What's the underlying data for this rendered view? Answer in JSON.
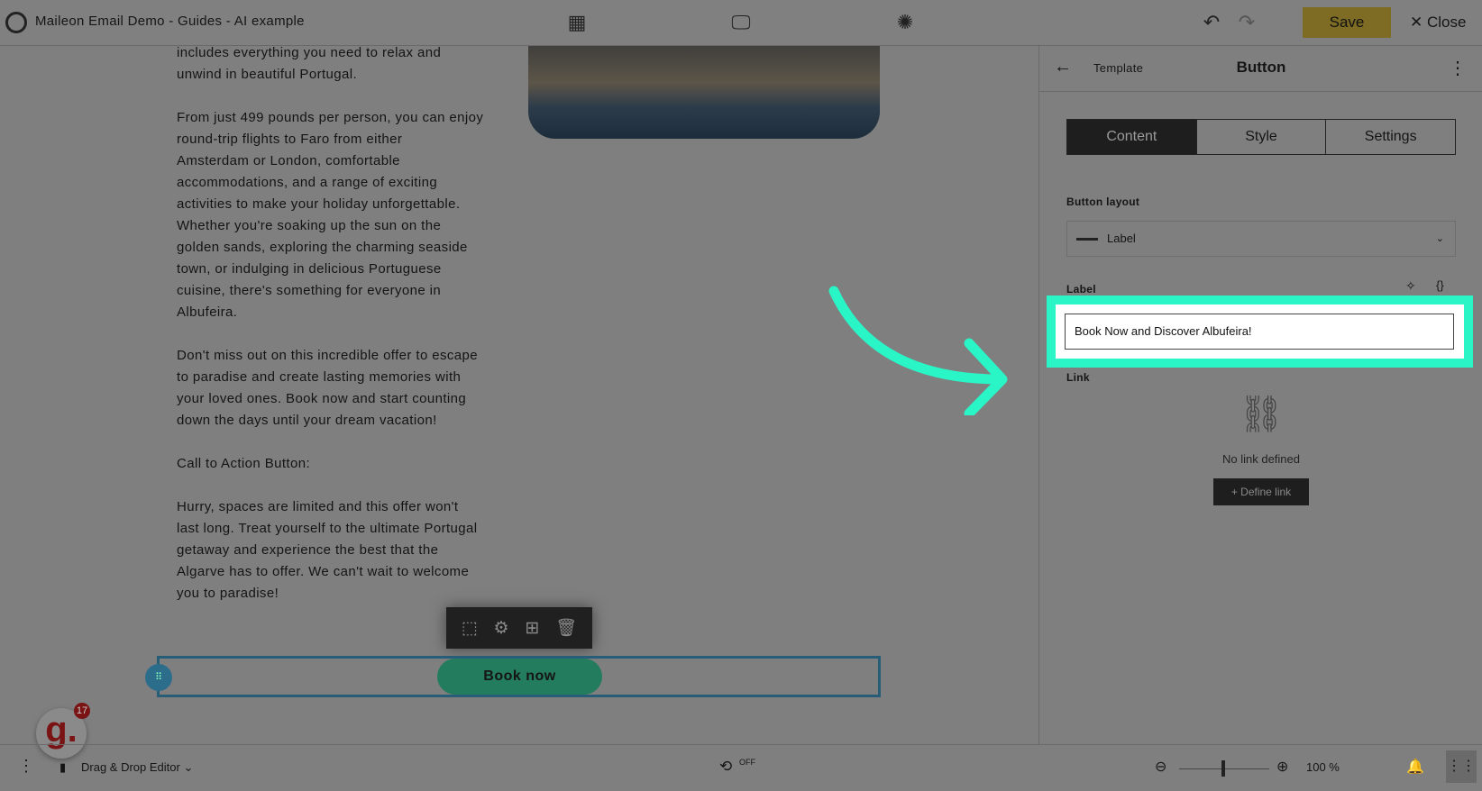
{
  "header": {
    "title": "Maileon Email Demo - Guides - AI example",
    "save_label": "Save",
    "close_label": "Close"
  },
  "canvas": {
    "paragraphs": [
      "includes everything you need to relax and\nunwind in beautiful Portugal.",
      "From just 499 pounds per person, you can enjoy\nround-trip flights to Faro from either\nAmsterdam or London, comfortable\naccommodations, and a range of exciting\nactivities to make your holiday unforgettable.\nWhether you're soaking up the sun on the\ngolden sands, exploring the charming seaside\ntown, or indulging in delicious Portuguese\ncuisine, there's something for everyone in\nAlbufeira.",
      "Don't miss out on this incredible offer to escape\nto paradise and create lasting memories with\nyour loved ones. Book now and start counting\ndown the days until your dream vacation!",
      "Call to Action Button:",
      "Hurry, spaces are limited and this offer won't\nlast long. Treat yourself to the ultimate Portugal\ngetaway and experience the best that the\nAlgarve has to offer. We can't wait to welcome\nyou to paradise!"
    ],
    "button_label": "Book now",
    "notification_count": "17",
    "logo_letter": "g."
  },
  "panel": {
    "back_label": "Template",
    "title": "Button",
    "tabs": [
      {
        "label": "Content"
      },
      {
        "label": "Style"
      },
      {
        "label": "Settings"
      }
    ],
    "button_layout_label": "Button layout",
    "button_layout_value": "Label",
    "label_label": "Label",
    "label_value": "Book Now and Discover Albufeira!",
    "link_label": "Link",
    "no_link_text": "No link defined",
    "define_link_label": "Define link"
  },
  "footer": {
    "editor_mode": "Drag & Drop Editor",
    "autosave": "OFF",
    "zoom": "100 %"
  },
  "colors": {
    "highlight": "#2af5c7",
    "save": "#7e6c24",
    "button": "#247c5e"
  }
}
